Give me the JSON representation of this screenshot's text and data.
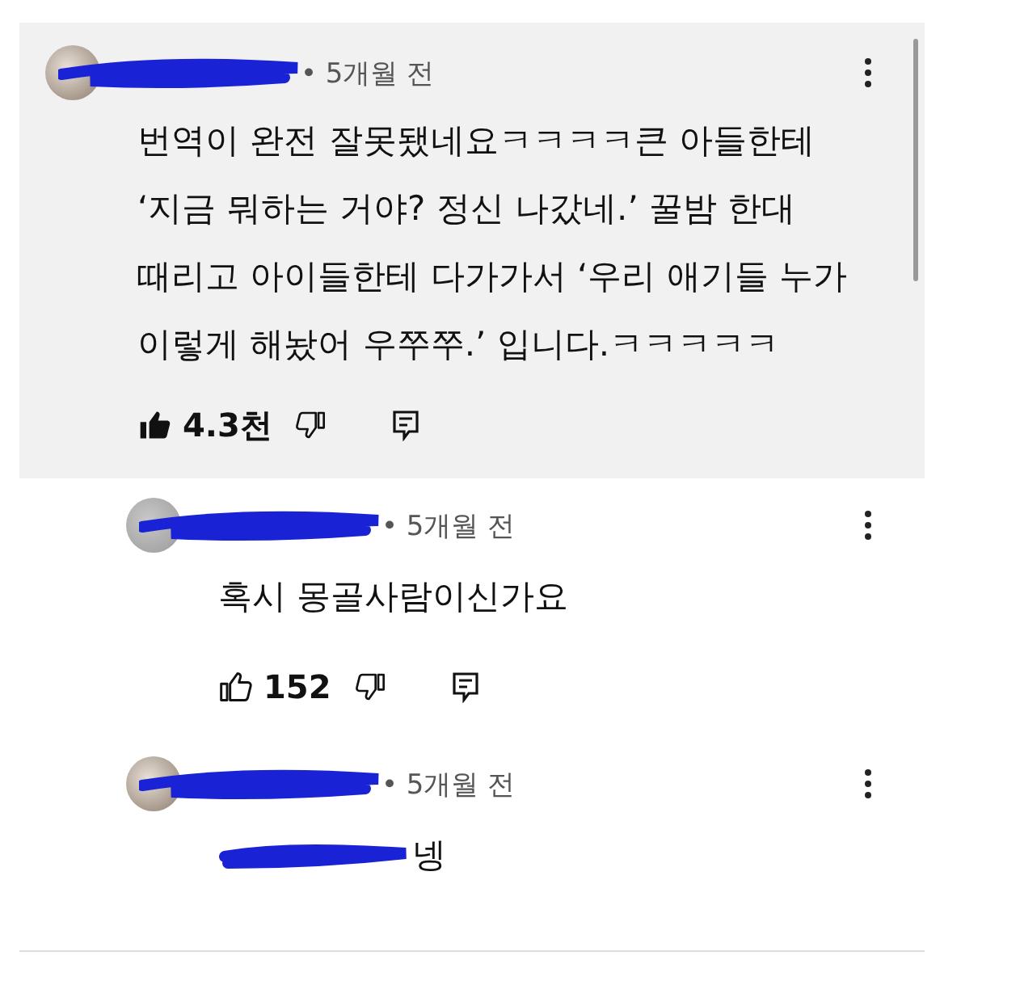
{
  "comments": [
    {
      "kind": "comment",
      "highlighted": true,
      "time": "• 5개월 전",
      "text": "번역이 완전 잘못됐네요ㅋㅋㅋㅋ큰 아들한테 ‘지금 뭐하는 거야? 정신 나갔네.’ 꿀밤 한대 때리고 아이들한테 다가가서 ‘우리 애기들 누가 이렇게 해놨어 우쭈쭈.’ 입니다.ㅋㅋㅋㅋㅋ",
      "likes": "4.3천",
      "liked": true
    },
    {
      "kind": "reply",
      "highlighted": false,
      "time": "• 5개월 전",
      "text": "혹시 몽골사람이신가요",
      "likes": "152",
      "liked": false
    },
    {
      "kind": "reply",
      "highlighted": false,
      "time": "• 5개월 전",
      "text": "넹",
      "mention_redacted": true
    }
  ]
}
